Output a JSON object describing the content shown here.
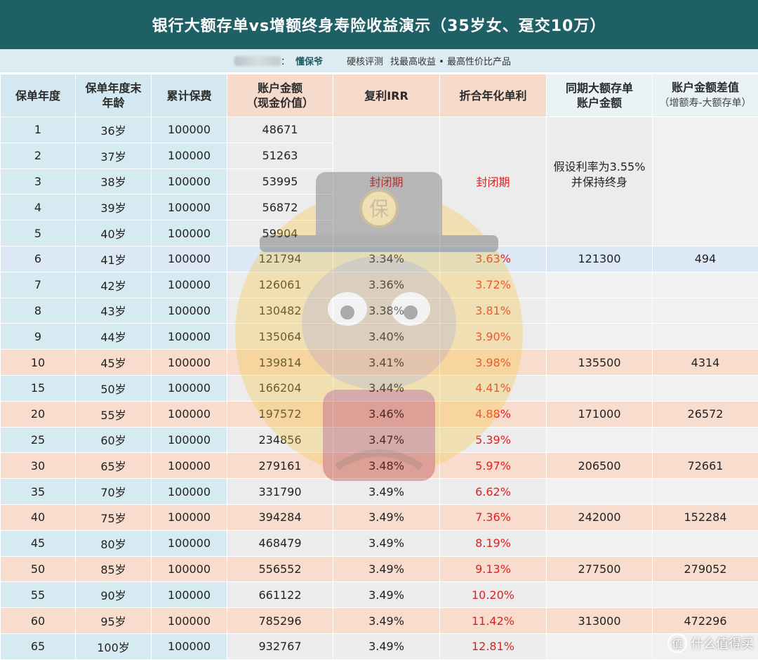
{
  "title": "银行大额存单vs增额终身寿险收益演示（35岁女、趸交10万）",
  "subtitle": {
    "brand": "懂保爷",
    "slogan1": "硬核评测",
    "slogan2": "找最高收益 • 最高性价比产品"
  },
  "headers": {
    "h1": "保单年度",
    "h2_line1": "保单年度末",
    "h2_line2": "年龄",
    "h3": "累计保费",
    "h4_line1": "账户金额",
    "h4_line2": "（现金价值）",
    "h5": "复利IRR",
    "h6": "折合年化单利",
    "h7_line1": "同期大额存单",
    "h7_line2": "账户金额",
    "h8_line1": "账户金额差值",
    "h8_line2": "（增额寿-大额存单）"
  },
  "closed_period": "封闭期",
  "deposit_note_line1": "假设利率为3.55%",
  "deposit_note_line2": "并保持终身",
  "rows": [
    {
      "year": "1",
      "age": "36岁",
      "premium": "100000",
      "value": "48671"
    },
    {
      "year": "2",
      "age": "37岁",
      "premium": "100000",
      "value": "51263"
    },
    {
      "year": "3",
      "age": "38岁",
      "premium": "100000",
      "value": "53995"
    },
    {
      "year": "4",
      "age": "39岁",
      "premium": "100000",
      "value": "56872"
    },
    {
      "year": "5",
      "age": "40岁",
      "premium": "100000",
      "value": "59904"
    },
    {
      "year": "6",
      "age": "41岁",
      "premium": "100000",
      "value": "121794",
      "irr": "3.34%",
      "simple": "3.63%",
      "deposit": "121300",
      "diff": "494"
    },
    {
      "year": "7",
      "age": "42岁",
      "premium": "100000",
      "value": "126061",
      "irr": "3.36%",
      "simple": "3.72%"
    },
    {
      "year": "8",
      "age": "43岁",
      "premium": "100000",
      "value": "130482",
      "irr": "3.38%",
      "simple": "3.81%"
    },
    {
      "year": "9",
      "age": "44岁",
      "premium": "100000",
      "value": "135064",
      "irr": "3.40%",
      "simple": "3.90%"
    },
    {
      "year": "10",
      "age": "45岁",
      "premium": "100000",
      "value": "139814",
      "irr": "3.41%",
      "simple": "3.98%",
      "deposit": "135500",
      "diff": "4314"
    },
    {
      "year": "15",
      "age": "50岁",
      "premium": "100000",
      "value": "166204",
      "irr": "3.44%",
      "simple": "4.41%"
    },
    {
      "year": "20",
      "age": "55岁",
      "premium": "100000",
      "value": "197572",
      "irr": "3.46%",
      "simple": "4.88%",
      "deposit": "171000",
      "diff": "26572"
    },
    {
      "year": "25",
      "age": "60岁",
      "premium": "100000",
      "value": "234856",
      "irr": "3.47%",
      "simple": "5.39%"
    },
    {
      "year": "30",
      "age": "65岁",
      "premium": "100000",
      "value": "279161",
      "irr": "3.48%",
      "simple": "5.97%",
      "deposit": "206500",
      "diff": "72661"
    },
    {
      "year": "35",
      "age": "70岁",
      "premium": "100000",
      "value": "331790",
      "irr": "3.49%",
      "simple": "6.62%"
    },
    {
      "year": "40",
      "age": "75岁",
      "premium": "100000",
      "value": "394284",
      "irr": "3.49%",
      "simple": "7.36%",
      "deposit": "242000",
      "diff": "152284"
    },
    {
      "year": "45",
      "age": "80岁",
      "premium": "100000",
      "value": "468479",
      "irr": "3.49%",
      "simple": "8.19%"
    },
    {
      "year": "50",
      "age": "85岁",
      "premium": "100000",
      "value": "556552",
      "irr": "3.49%",
      "simple": "9.13%",
      "deposit": "277500",
      "diff": "279052"
    },
    {
      "year": "55",
      "age": "90岁",
      "premium": "100000",
      "value": "661122",
      "irr": "3.49%",
      "simple": "10.20%"
    },
    {
      "year": "60",
      "age": "95岁",
      "premium": "100000",
      "value": "785296",
      "irr": "3.49%",
      "simple": "11.42%",
      "deposit": "313000",
      "diff": "472296"
    },
    {
      "year": "65",
      "age": "100岁",
      "premium": "100000",
      "value": "932767",
      "irr": "3.49%",
      "simple": "12.81%"
    }
  ],
  "watermark_char": "保",
  "site_logo": "值",
  "site_name": "什么值得买",
  "colors": {
    "header_bg": "#1f5f66",
    "highlight_red": "#e02020",
    "row_pink": "#f8dccd",
    "row_blue": "#d6eaf2"
  }
}
